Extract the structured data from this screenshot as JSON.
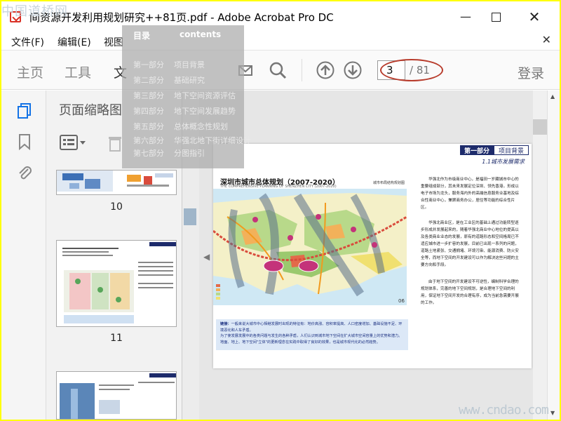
{
  "watermark": {
    "logo": "中国道桥网",
    "site": "www.cndao.com"
  },
  "window": {
    "title": "间资源开发利用规划研究++81页.pdf - Adobe Acrobat Pro DC"
  },
  "menu": {
    "items": [
      "文件(F)",
      "编辑(E)",
      "视图"
    ]
  },
  "toolbar": {
    "tabs": [
      "主页",
      "工具",
      "文"
    ],
    "page_current": "3",
    "page_total": "/ 81",
    "login": "登录"
  },
  "thumbnails": {
    "title": "页面缩略图",
    "pages": [
      "10",
      "11"
    ]
  },
  "contents_overlay": {
    "head_cn": "目录",
    "head_en": "contents",
    "items": [
      {
        "num": "第一部分",
        "label": "项目背景"
      },
      {
        "num": "第二部分",
        "label": "基础研究"
      },
      {
        "num": "第三部分",
        "label": "地下空间资源评估"
      },
      {
        "num": "第四部分",
        "label": "地下空间发展趋势"
      },
      {
        "num": "第五部分",
        "label": "总体概念性规划"
      },
      {
        "num": "第六部分",
        "label": "华强北地下街详细设计"
      },
      {
        "num": "第七部分",
        "label": "分图指引"
      }
    ]
  },
  "document_page": {
    "section_num": "第一部分",
    "section_name": "项目背景",
    "subheading": "1.1城市发展需求",
    "map_title": "深圳市城市总体规划（2007-2020）",
    "map_subtitle": "THE COMPREHENSIVE PLANNING OF SHENZHEN CITY (2007-2020)",
    "map_source": "城市布局结构规划图",
    "page_number": "06",
    "paragraphs": [
      "华强北作为市级商业中心，是福田一岁藏城市中心的重要组成部分，其未来发展定位深圳、领先香港，形成以电子市场为龙头，服务海内外的高端信息服务业基地及综合性商业中心，兼顾商务办公，居住等功能的综合性片区。",
      "华强北商业区，是在工业区的基础上通过功能转型逐步形成并发展起来的，随着华强北商业中心地位的提高以及各类商业业态的发展，原有的道路形态和空间格局已不适应城市进一步扩容的发展，目前已出现一系列的问题，道路土地紧张、交通拥堵、环境污染、能源消费、防火安全等，而地下空间的开发建设可以作为解决这些问题的主要方向和手段。",
      "由于地下空间的开发建设不可逆性，编制科学合理的规划体系，完善的地下空间规划，是合理地下空间的利用，保证地下空间开发的合理有序，成为当前急需要开展的工作。"
    ],
    "note_label": "链接：",
    "note_lines": [
      "一般来说大城市中心相继发展时出现的特征有：地价高涨、容积率提高、人口密度增加、基础设施不足、环境恶化和人车矛盾。",
      "为了使发展发展中的各类问题与发生的各种矛盾，人们认识到城市地下空间在扩大城市空间容量上的优势和潜力。地面、地上、地下空间\"立体\"的更新理念在实践中取得了良好的效果，也是城市现代化的必然趋势。"
    ]
  }
}
